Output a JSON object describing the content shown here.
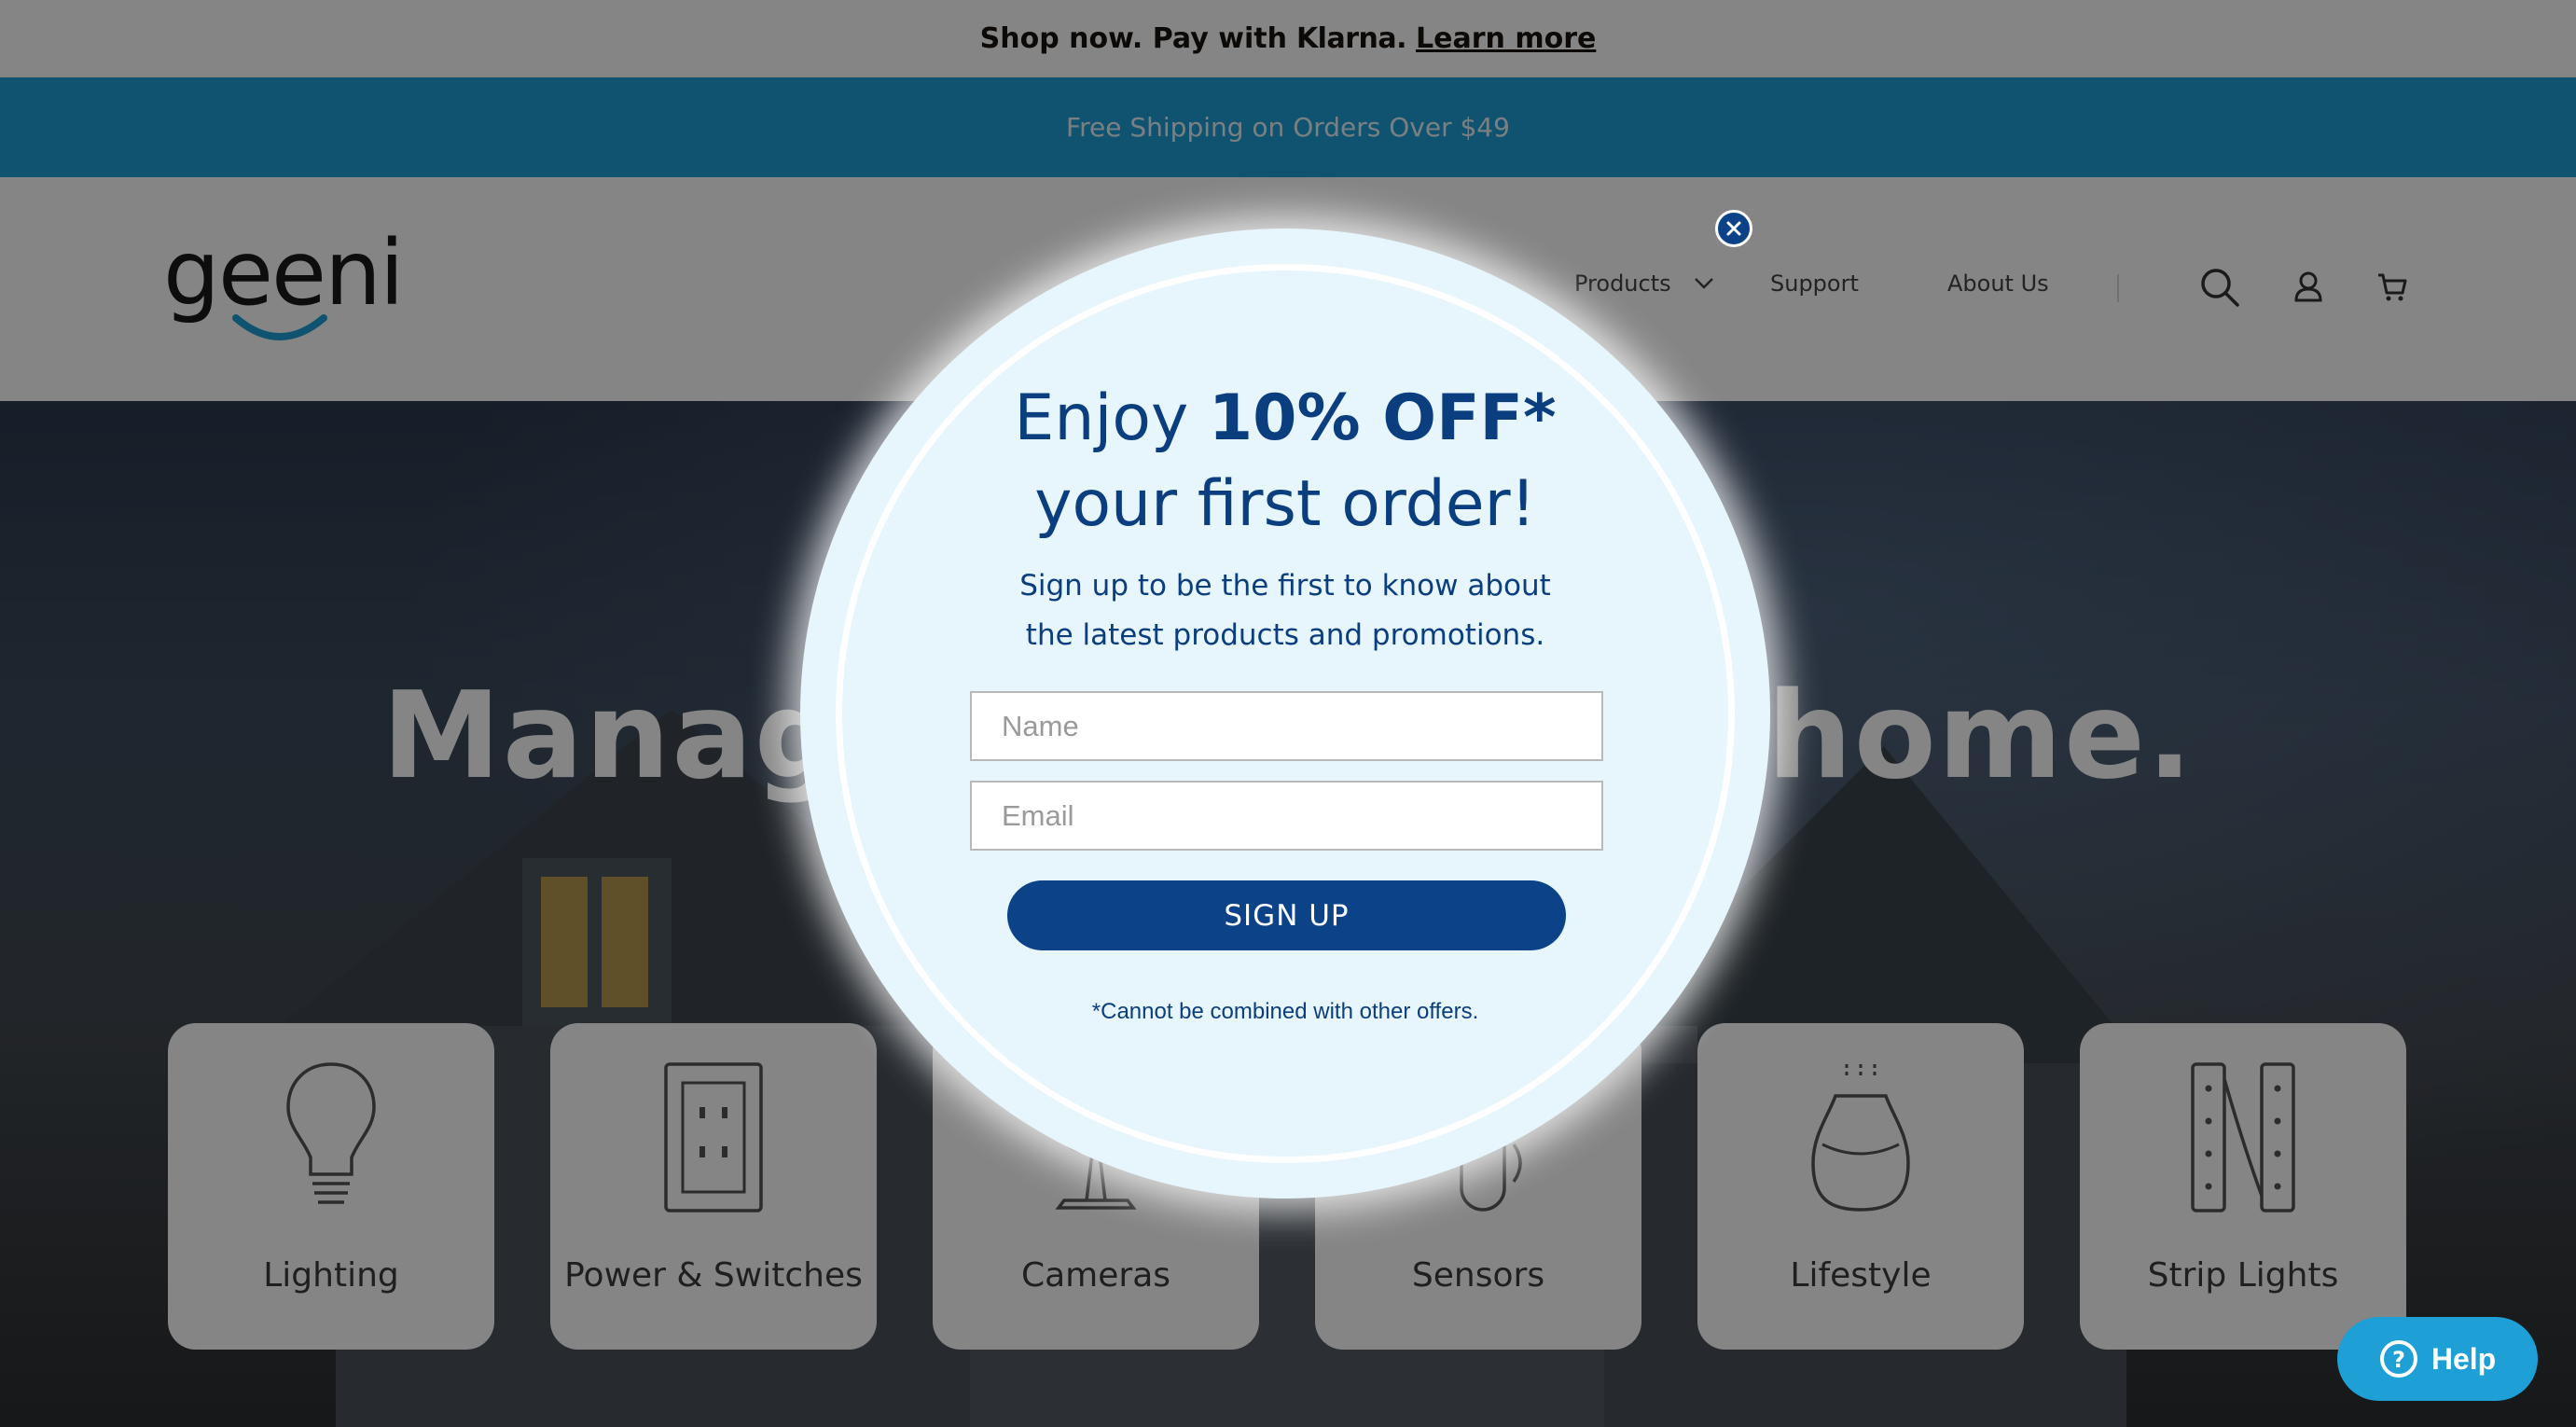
{
  "promo_bar": {
    "text": "Shop now. Pay with",
    "brand": "Klarna.",
    "link": "Learn more"
  },
  "shipping_bar": {
    "text": "Free Shipping on Orders Over $49"
  },
  "header": {
    "logo": "geeni",
    "nav": {
      "products": "Products",
      "support": "Support",
      "about": "About Us"
    },
    "icons": [
      "search-icon",
      "account-icon",
      "cart-icon"
    ]
  },
  "hero": {
    "title": "Manage your smart home."
  },
  "categories": [
    {
      "label": "Lighting",
      "icon": "bulb-icon"
    },
    {
      "label": "Power & Switches",
      "icon": "outlet-icon"
    },
    {
      "label": "Cameras",
      "icon": "camera-icon"
    },
    {
      "label": "Sensors",
      "icon": "sensor-icon"
    },
    {
      "label": "Lifestyle",
      "icon": "diffuser-icon"
    },
    {
      "label": "Strip Lights",
      "icon": "strip-light-icon"
    }
  ],
  "popup": {
    "title_prefix": "Enjoy",
    "title_bold": "10% OFF*",
    "title_line2": "your first order!",
    "subtitle": "Sign up to be the first to know about the latest products and promotions.",
    "name_placeholder": "Name",
    "email_placeholder": "Email",
    "button": "SIGN UP",
    "disclaimer": "*Cannot be combined with other offers."
  },
  "help": {
    "label": "Help"
  },
  "colors": {
    "brand_blue": "#1e9fd6",
    "popup_navy": "#0b4288",
    "popup_bg": "#e7f5fc"
  }
}
